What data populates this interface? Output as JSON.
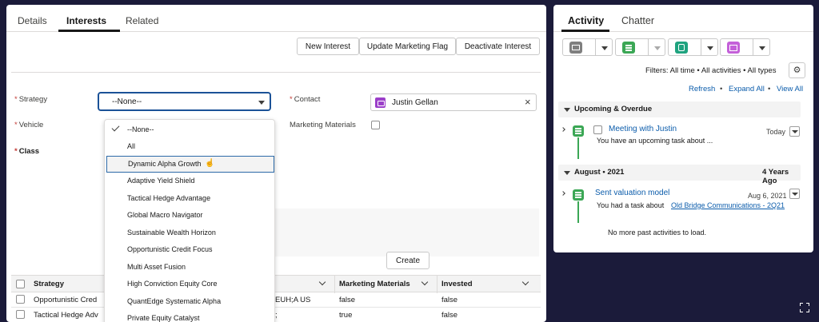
{
  "left_tabs": [
    "Details",
    "Interests",
    "Related"
  ],
  "toolbar": {
    "new_interest": "New Interest",
    "update_marketing_flag": "Update Marketing Flag",
    "deactivate_interest": "Deactivate Interest"
  },
  "form": {
    "required_mark": "*",
    "strategy_label": "Strategy",
    "strategy_value": "--None--",
    "contact_label": "Contact",
    "contact_value": "Justin Gellan",
    "vehicle_label": "Vehicle",
    "marketing_materials_label": "Marketing Materials",
    "class_label": "Class"
  },
  "dropdown": {
    "options": [
      "--None--",
      "All",
      "Dynamic Alpha Growth",
      "Adaptive Yield Shield",
      "Tactical Hedge Advantage",
      "Global Macro Navigator",
      "Sustainable Wealth Horizon",
      "Opportunistic Credit Focus",
      "Multi Asset Fusion",
      "High Conviction Equity Core",
      "QuantEdge Systematic Alpha",
      "Private Equity Catalyst"
    ],
    "selected": "--None--",
    "hovered": "Dynamic Alpha Growth"
  },
  "create_button": "Create",
  "table": {
    "headers": [
      "Strategy",
      "Marketing Materials",
      "Invested"
    ],
    "rows": [
      {
        "strategy": "Opportunistic Cred",
        "vehicle": "EUH;A US",
        "marketing": "false",
        "invested": "false"
      },
      {
        "strategy": "Tactical Hedge Adv",
        "vehicle": ";",
        "marketing": "true",
        "invested": "false"
      }
    ]
  },
  "right_tabs": [
    "Activity",
    "Chatter"
  ],
  "activity": {
    "filters": "Filters: All time • All activities • All types",
    "refresh": "Refresh",
    "expand_all": "Expand All",
    "view_all": "View All",
    "sep": "•",
    "upcoming_title": "Upcoming & Overdue",
    "upcoming_item": {
      "title": "Meeting with Justin",
      "date": "Today",
      "desc": "You have an upcoming task about ..."
    },
    "month_title": "August • 2021",
    "month_age": "4 Years Ago",
    "past_item": {
      "title": "Sent valuation model",
      "date": "Aug 6, 2021",
      "desc": "You had a task about",
      "link": "Old Bridge Communications - 2Q21"
    },
    "no_more": "No more past activities to load."
  },
  "colors": {
    "brand_blue": "#1b5297",
    "link_blue": "#0b5cab",
    "task_green": "#3ba755",
    "event_purple": "#c460d9",
    "email_gray": "#7f8c8d",
    "call_green": "#1fa37f",
    "background": "#1b1b3a"
  }
}
